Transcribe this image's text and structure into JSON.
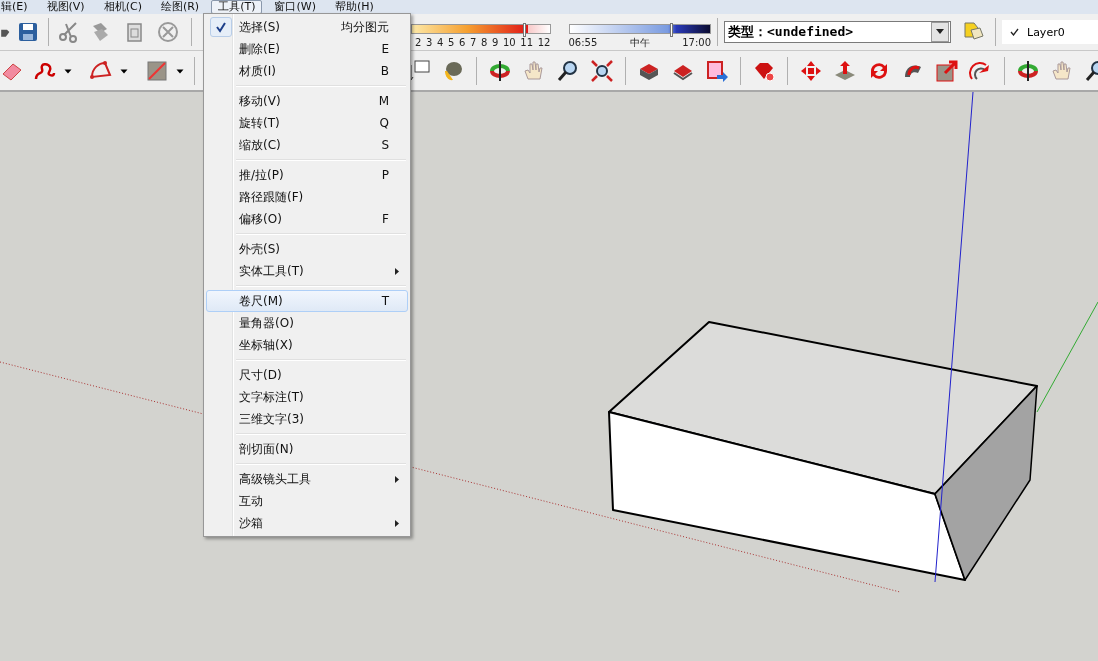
{
  "menu_bar": [
    {
      "label": "辑(E)",
      "selected": false
    },
    {
      "label": "视图(V)",
      "selected": false
    },
    {
      "label": "相机(C)",
      "selected": false
    },
    {
      "label": "绘图(R)",
      "selected": false
    },
    {
      "label": "工具(T)",
      "selected": true
    },
    {
      "label": "窗口(W)",
      "selected": false
    },
    {
      "label": "帮助(H)",
      "selected": false
    }
  ],
  "shadow_settings": {
    "month_slider": {
      "labels": [
        "2",
        "3",
        "4",
        "5",
        "6",
        "7",
        "8",
        "9",
        "10",
        "11",
        "12"
      ],
      "level": 0.82
    },
    "time_slider": {
      "start": "06:55",
      "mid": "中午",
      "end": "17:00",
      "level": 0.73
    }
  },
  "entity_info": {
    "label": "类型：",
    "value": "<undefined>"
  },
  "layer": {
    "checked": true,
    "name": "Layer0"
  },
  "tools_menu": {
    "groups": [
      [
        {
          "label": "选择(S)",
          "shortcut": "均分图元",
          "checked": true,
          "selected": false,
          "submenu": false
        },
        {
          "label": "删除(E)",
          "shortcut": "E",
          "checked": false,
          "selected": false,
          "submenu": false
        },
        {
          "label": "材质(I)",
          "shortcut": "B",
          "checked": false,
          "selected": false,
          "submenu": false
        }
      ],
      [
        {
          "label": "移动(V)",
          "shortcut": "M",
          "checked": false,
          "selected": false,
          "submenu": false
        },
        {
          "label": "旋转(T)",
          "shortcut": "Q",
          "checked": false,
          "selected": false,
          "submenu": false
        },
        {
          "label": "缩放(C)",
          "shortcut": "S",
          "checked": false,
          "selected": false,
          "submenu": false
        }
      ],
      [
        {
          "label": "推/拉(P)",
          "shortcut": "P",
          "checked": false,
          "selected": false,
          "submenu": false
        },
        {
          "label": "路径跟随(F)",
          "checked": false,
          "selected": false,
          "submenu": false
        },
        {
          "label": "偏移(O)",
          "shortcut": "F",
          "checked": false,
          "selected": false,
          "submenu": false
        }
      ],
      [
        {
          "label": "外壳(S)",
          "checked": false,
          "selected": false,
          "submenu": false
        },
        {
          "label": "实体工具(T)",
          "checked": false,
          "selected": false,
          "submenu": true
        }
      ],
      [
        {
          "label": "卷尺(M)",
          "shortcut": "T",
          "checked": false,
          "selected": true,
          "submenu": false
        },
        {
          "label": "量角器(O)",
          "checked": false,
          "selected": false,
          "submenu": false
        },
        {
          "label": "坐标轴(X)",
          "checked": false,
          "selected": false,
          "submenu": false
        }
      ],
      [
        {
          "label": "尺寸(D)",
          "checked": false,
          "selected": false,
          "submenu": false
        },
        {
          "label": "文字标注(T)",
          "checked": false,
          "selected": false,
          "submenu": false
        },
        {
          "label": "三维文字(3)",
          "checked": false,
          "selected": false,
          "submenu": false
        }
      ],
      [
        {
          "label": "剖切面(N)",
          "checked": false,
          "selected": false,
          "submenu": false
        }
      ],
      [
        {
          "label": "高级镜头工具",
          "checked": false,
          "selected": false,
          "submenu": true
        },
        {
          "label": "互动",
          "checked": false,
          "selected": false,
          "submenu": false
        },
        {
          "label": "沙箱",
          "checked": false,
          "selected": false,
          "submenu": true
        }
      ]
    ]
  }
}
